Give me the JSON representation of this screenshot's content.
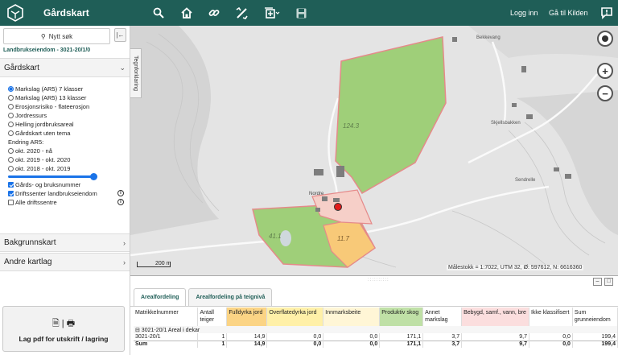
{
  "app": {
    "title": "Gårdskart"
  },
  "topbar": {
    "icons": [
      "search-icon",
      "home-icon",
      "link-icon",
      "measure-tools-icon",
      "add-layer-icon",
      "save-icon"
    ],
    "login_label": "Logg inn",
    "kilden_label": "Gå til Kilden",
    "feedback_icon": "feedback-icon"
  },
  "sidebar": {
    "new_search_label": "Nytt søk",
    "collapse_icon": "collapse-left-icon",
    "property_label": "Landbrukseiendom - 3021-20/1/0",
    "gardskart_section": "Gårdskart",
    "themes": [
      {
        "label": "Markslag (AR5) 7 klasser",
        "selected": true
      },
      {
        "label": "Markslag (AR5) 13 klasser",
        "selected": false
      },
      {
        "label": "Erosjonsrisiko - flateerosjon",
        "selected": false
      },
      {
        "label": "Jordressurs",
        "selected": false
      },
      {
        "label": "Helling jordbruksareal",
        "selected": false
      },
      {
        "label": "Gårdskart uten tema",
        "selected": false
      }
    ],
    "change_heading": "Endring AR5:",
    "changes": [
      {
        "label": "okt. 2020 - nå",
        "selected": false
      },
      {
        "label": "okt. 2019 - okt. 2020",
        "selected": false
      },
      {
        "label": "okt. 2018 - okt. 2019",
        "selected": false
      }
    ],
    "opacity_slider": 1.0,
    "checks": [
      {
        "label": "Gårds- og bruksnummer",
        "checked": true,
        "info": false
      },
      {
        "label": "Driftssenter landbrukseiendom",
        "checked": true,
        "info": true
      },
      {
        "label": "Alle driftssentre",
        "checked": false,
        "info": true
      }
    ],
    "background_section": "Bakgrunnskart",
    "other_layers_section": "Andre kartlag",
    "pdf_button_label": "Lag pdf for utskrift / lagring"
  },
  "map": {
    "draw_tab_label": "Tegnforklaring",
    "scale_bar_label": "200 m",
    "scale_info": "Målestokk = 1:7022, UTM 32, Ø:  597612, N: 6616360",
    "area_labels": [
      "124.3",
      "41.1",
      "11.7"
    ],
    "place_labels": [
      "Bekkevang",
      "Sendrelle",
      "Nordre",
      "Skjellsbakken"
    ],
    "colors": {
      "cultivated": "#f8c978",
      "forest": "#9fcf79",
      "built": "#f6cfc8",
      "boundary": "#e58a8a",
      "marker": "#e21b1b"
    }
  },
  "bottom_panel": {
    "tabs": [
      "Arealfordeling",
      "Arealfordeling på teignivå"
    ],
    "columns": [
      "Matrikkelnummer",
      "Antall teiger",
      "Fulldyrka jord",
      "Overflatedyrka jord",
      "Innmarksbeite",
      "Produktiv skog",
      "Annet markslag",
      "Bebygd, samf., vann, bre",
      "Ikke klassifisert",
      "Sum grunneiendom"
    ],
    "column_colors": [
      "#ffffff",
      "#ffffff",
      "#fbd485",
      "#fff0a8",
      "#fff6d6",
      "#bfe0a6",
      "#ffffff",
      "#fbdede",
      "#ffffff",
      "#ffffff"
    ],
    "group_label": "⊟ 3021-20/1  Areal i dekar",
    "rows": [
      [
        "3021-20/1",
        "1",
        "14,9",
        "0,0",
        "0,0",
        "171,1",
        "3,7",
        "9,7",
        "0,0",
        "199,4"
      ],
      [
        "Sum",
        "1",
        "14,9",
        "0,0",
        "0,0",
        "171,1",
        "3,7",
        "9,7",
        "0,0",
        "199,4"
      ]
    ]
  }
}
